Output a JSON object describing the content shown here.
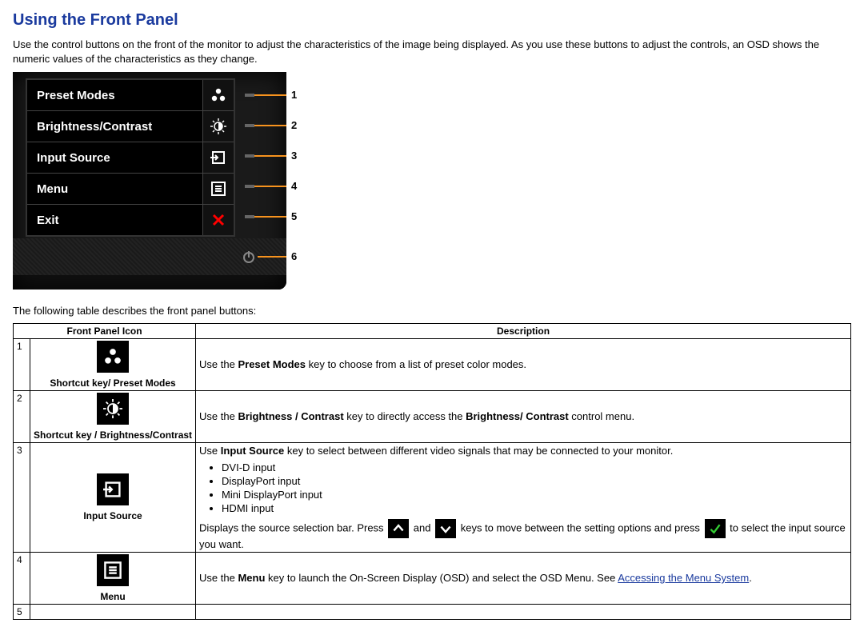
{
  "heading": "Using the Front Panel",
  "intro": "Use the control buttons on the front of the monitor to adjust the characteristics of the image being displayed. As you use these buttons to adjust the controls, an OSD shows the numeric values of the characteristics as they change.",
  "diagram": {
    "rows": [
      {
        "label": "Preset Modes",
        "icon": "preset-modes-icon",
        "num": "1"
      },
      {
        "label": "Brightness/Contrast",
        "icon": "brightness-icon",
        "num": "2"
      },
      {
        "label": "Input Source",
        "icon": "input-source-icon",
        "num": "3"
      },
      {
        "label": "Menu",
        "icon": "menu-icon",
        "num": "4"
      },
      {
        "label": "Exit",
        "icon": "close-icon",
        "num": "5"
      }
    ],
    "power_num": "6"
  },
  "table_intro": "The following table describes the front panel buttons:",
  "table": {
    "headers": [
      "Front Panel Icon",
      "Description"
    ],
    "rows": [
      {
        "num": "1",
        "icon_label": "Shortcut key/ Preset Modes",
        "icon": "preset-modes-icon",
        "desc_pre": "Use the ",
        "desc_bold": "Preset Modes",
        "desc_post": " key to choose from a list of preset color modes."
      },
      {
        "num": "2",
        "icon_label": "Shortcut key / Brightness/Contrast",
        "icon": "brightness-icon",
        "desc_pre": "Use the ",
        "desc_bold": "Brightness / Contrast",
        "desc_mid": " key to directly access the ",
        "desc_bold2": "Brightness/ Contrast",
        "desc_post": " control menu."
      },
      {
        "num": "3",
        "icon_label": "Input Source",
        "icon": "input-source-icon",
        "line1_pre": "Use ",
        "line1_bold": "Input Source",
        "line1_post": " key to select between different video signals that may be connected to your monitor.",
        "list": [
          "DVI-D input",
          "DisplayPort input",
          "Mini DisplayPort input",
          "HDMI input"
        ],
        "line2_a": "Displays the source selection bar. Press ",
        "line2_b": " and ",
        "line2_c": " keys to move between the setting options and press ",
        "line2_d": " to select the input source you want."
      },
      {
        "num": "4",
        "icon_label": "Menu",
        "icon": "menu-icon",
        "desc_pre": "Use the ",
        "desc_bold": "Menu",
        "desc_post": " key to launch the On-Screen Display (OSD) and select the OSD Menu. See ",
        "link": "Accessing the Menu System",
        "desc_end": "."
      },
      {
        "num": "5"
      }
    ]
  }
}
